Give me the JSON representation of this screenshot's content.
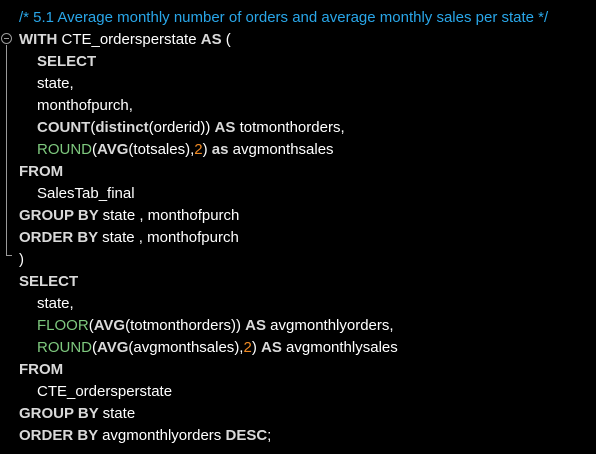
{
  "editor": {
    "lines": [
      {
        "indent": 0,
        "tokens": [
          {
            "t": "comment",
            "v": "/* 5.1 Average monthly number of orders and average monthly sales per state */"
          }
        ]
      },
      {
        "indent": 0,
        "tokens": [
          {
            "t": "kw",
            "v": "WITH "
          },
          {
            "t": "id",
            "v": "CTE_ordersperstate "
          },
          {
            "t": "kw",
            "v": "AS"
          },
          {
            "t": "p",
            "v": " ("
          }
        ]
      },
      {
        "indent": 1,
        "tokens": [
          {
            "t": "kw",
            "v": "SELECT"
          }
        ]
      },
      {
        "indent": 1,
        "tokens": [
          {
            "t": "id",
            "v": "state"
          },
          {
            "t": "p",
            "v": ","
          }
        ]
      },
      {
        "indent": 1,
        "tokens": [
          {
            "t": "id",
            "v": "monthofpurch"
          },
          {
            "t": "p",
            "v": ","
          }
        ]
      },
      {
        "indent": 1,
        "tokens": [
          {
            "t": "kw",
            "v": "COUNT"
          },
          {
            "t": "p",
            "v": "("
          },
          {
            "t": "kw",
            "v": "distinct"
          },
          {
            "t": "p",
            "v": "("
          },
          {
            "t": "id",
            "v": "orderid"
          },
          {
            "t": "p",
            "v": ")) "
          },
          {
            "t": "kw",
            "v": "AS "
          },
          {
            "t": "id",
            "v": "totmonthorders"
          },
          {
            "t": "p",
            "v": ","
          }
        ]
      },
      {
        "indent": 1,
        "tokens": [
          {
            "t": "fn",
            "v": "ROUND"
          },
          {
            "t": "p",
            "v": "("
          },
          {
            "t": "kw",
            "v": "AVG"
          },
          {
            "t": "p",
            "v": "("
          },
          {
            "t": "id",
            "v": "totsales"
          },
          {
            "t": "p",
            "v": "),"
          },
          {
            "t": "num",
            "v": "2"
          },
          {
            "t": "p",
            "v": ") "
          },
          {
            "t": "kw",
            "v": "as "
          },
          {
            "t": "id",
            "v": "avgmonthsales"
          }
        ]
      },
      {
        "indent": 0,
        "tokens": [
          {
            "t": "kw",
            "v": "FROM"
          }
        ]
      },
      {
        "indent": 1,
        "tokens": [
          {
            "t": "id",
            "v": "SalesTab_final"
          }
        ]
      },
      {
        "indent": 0,
        "tokens": [
          {
            "t": "kw",
            "v": "GROUP BY "
          },
          {
            "t": "id",
            "v": "state , monthofpurch"
          }
        ]
      },
      {
        "indent": 0,
        "tokens": [
          {
            "t": "kw",
            "v": "ORDER BY "
          },
          {
            "t": "id",
            "v": "state , monthofpurch"
          }
        ]
      },
      {
        "indent": 0,
        "tokens": [
          {
            "t": "p",
            "v": ")"
          }
        ]
      },
      {
        "indent": 0,
        "tokens": [
          {
            "t": "kw",
            "v": "SELECT"
          }
        ]
      },
      {
        "indent": 1,
        "tokens": [
          {
            "t": "id",
            "v": "state"
          },
          {
            "t": "p",
            "v": ","
          }
        ]
      },
      {
        "indent": 1,
        "tokens": [
          {
            "t": "fn",
            "v": "FLOOR"
          },
          {
            "t": "p",
            "v": "("
          },
          {
            "t": "kw",
            "v": "AVG"
          },
          {
            "t": "p",
            "v": "("
          },
          {
            "t": "id",
            "v": "totmonthorders"
          },
          {
            "t": "p",
            "v": ")) "
          },
          {
            "t": "kw",
            "v": "AS "
          },
          {
            "t": "id",
            "v": "avgmonthlyorders"
          },
          {
            "t": "p",
            "v": ","
          }
        ]
      },
      {
        "indent": 1,
        "tokens": [
          {
            "t": "fn",
            "v": "ROUND"
          },
          {
            "t": "p",
            "v": "("
          },
          {
            "t": "kw",
            "v": "AVG"
          },
          {
            "t": "p",
            "v": "("
          },
          {
            "t": "id",
            "v": "avgmonthsales"
          },
          {
            "t": "p",
            "v": "),"
          },
          {
            "t": "num",
            "v": "2"
          },
          {
            "t": "p",
            "v": ") "
          },
          {
            "t": "kw",
            "v": "AS "
          },
          {
            "t": "id",
            "v": "avgmonthlysales"
          }
        ]
      },
      {
        "indent": 0,
        "tokens": [
          {
            "t": "kw",
            "v": "FROM"
          }
        ]
      },
      {
        "indent": 1,
        "tokens": [
          {
            "t": "id",
            "v": "CTE_ordersperstate"
          }
        ]
      },
      {
        "indent": 0,
        "tokens": [
          {
            "t": "kw",
            "v": "GROUP BY "
          },
          {
            "t": "id",
            "v": "state"
          }
        ]
      },
      {
        "indent": 0,
        "tokens": [
          {
            "t": "kw",
            "v": "ORDER BY "
          },
          {
            "t": "id",
            "v": "avgmonthlyorders "
          },
          {
            "t": "kw",
            "v": "DESC"
          },
          {
            "t": "p",
            "v": ";"
          }
        ]
      }
    ]
  },
  "gutter": {
    "fold_icon": "fold-collapse-icon"
  },
  "colors": {
    "background": "#000000",
    "comment": "#29a6e8",
    "keyword": "#d9d9d9",
    "function": "#7ec87e",
    "number": "#f08a24",
    "identifier": "#ffffff",
    "fold_guide": "#9a9a9a"
  }
}
